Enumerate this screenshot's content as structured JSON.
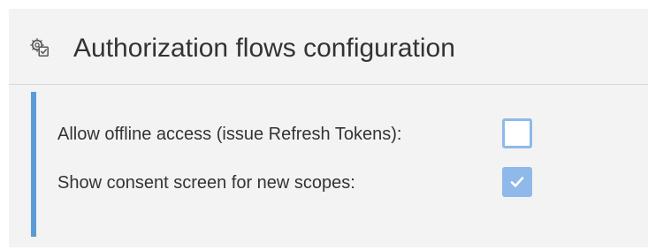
{
  "header": {
    "title": "Authorization flows configuration",
    "icon": "gear-checklist-icon"
  },
  "settings": [
    {
      "label": "Allow offline access (issue Refresh Tokens):",
      "checked": false
    },
    {
      "label": "Show consent screen for new scopes:",
      "checked": true
    }
  ],
  "colors": {
    "panel_background": "#f3f3f3",
    "accent": "#5b9bd5",
    "checkbox": "#8eb9ea",
    "text": "#333333"
  }
}
